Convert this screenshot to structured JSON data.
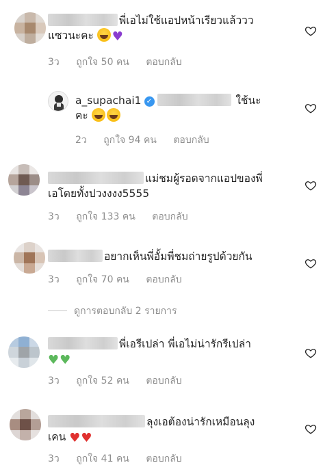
{
  "comments": [
    {
      "text_line1": "พี่เอไม่ใช้แอปหน้าเรียวแล้ววว",
      "text_line2": "แซวนะคะ",
      "time": "3ว",
      "likes": "ถูกใจ 50 คน",
      "reply": "ตอบกลับ",
      "avatar_colors": [
        "#d8d2cc",
        "#c9b9ab",
        "#e0dad4",
        "#c8b3a0",
        "#a8896e",
        "#d9c9bb",
        "#d6cfc8",
        "#bfae9e",
        "#e4ded8"
      ]
    },
    {
      "username": "a_supachai1",
      "text_line1": "ใช้นะ",
      "text_line2": "คะ",
      "time": "2ว",
      "likes": "ถูกใจ 94 คน",
      "reply": "ตอบกลับ"
    },
    {
      "text_line1": "แม่ชมผู้รอดจากแอปของพี่",
      "text_line2": "เอโดยทั้งปวงงงง5555",
      "time": "3ว",
      "likes": "ถูกใจ 133 คน",
      "reply": "ตอบกลับ",
      "avatar_colors": [
        "#e8e4e2",
        "#c7bdb8",
        "#ebe7e5",
        "#b6a59c",
        "#6f5a52",
        "#9c8d87",
        "#d2d0d2",
        "#8d8594",
        "#c9c4cb"
      ]
    },
    {
      "text_line1": "อยากเห็นพี่อั้มพี่ชมถ่ายรูปด้วยกัน",
      "time": "3ว",
      "likes": "ถูกใจ 70 คน",
      "reply": "ตอบกลับ",
      "avatar_colors": [
        "#eae6e4",
        "#ddd2ca",
        "#e9e4e1",
        "#cbb6a6",
        "#a07558",
        "#d8c4b5",
        "#e3dcd7",
        "#c9a993",
        "#e6dfda"
      ]
    },
    {
      "text_line1": "พี่เอรีเปล่า พี่เอไม่น่ารักรีเปล่า",
      "time": "3ว",
      "likes": "ถูกใจ 52 คน",
      "reply": "ตอบกลับ",
      "avatar_colors": [
        "#b7cbe0",
        "#8fb0d3",
        "#cbd8e6",
        "#cfd6dc",
        "#9fa4a8",
        "#bcc5cc",
        "#e7ebee",
        "#c9d1d8",
        "#e0e6ea"
      ]
    },
    {
      "text_line1": "ลุงเอต้องน่ารักเหมือนลุง",
      "text_line2": "เคน",
      "time": "3ว",
      "likes": "ถูกใจ 41 คน",
      "reply": "ตอบกลับ",
      "avatar_colors": [
        "#e3dfdd",
        "#b9a69c",
        "#e2dedc",
        "#a88d81",
        "#6e5148",
        "#b39e95",
        "#ddd6d4",
        "#c3b1aa",
        "#e6e1df"
      ]
    }
  ],
  "view_replies": "ดูการตอบกลับ 2 รายการ",
  "icons": {
    "like": "heart-outline-icon",
    "verified": "verified-badge-icon",
    "laugh": "face-with-tears-of-joy-icon",
    "purple_heart": "purple-heart-icon",
    "green_heart": "green-heart-icon",
    "red_heart": "red-heart-icon"
  },
  "colors": {
    "text": "#262626",
    "meta": "#8e8e8e",
    "verified": "#3897f0"
  }
}
